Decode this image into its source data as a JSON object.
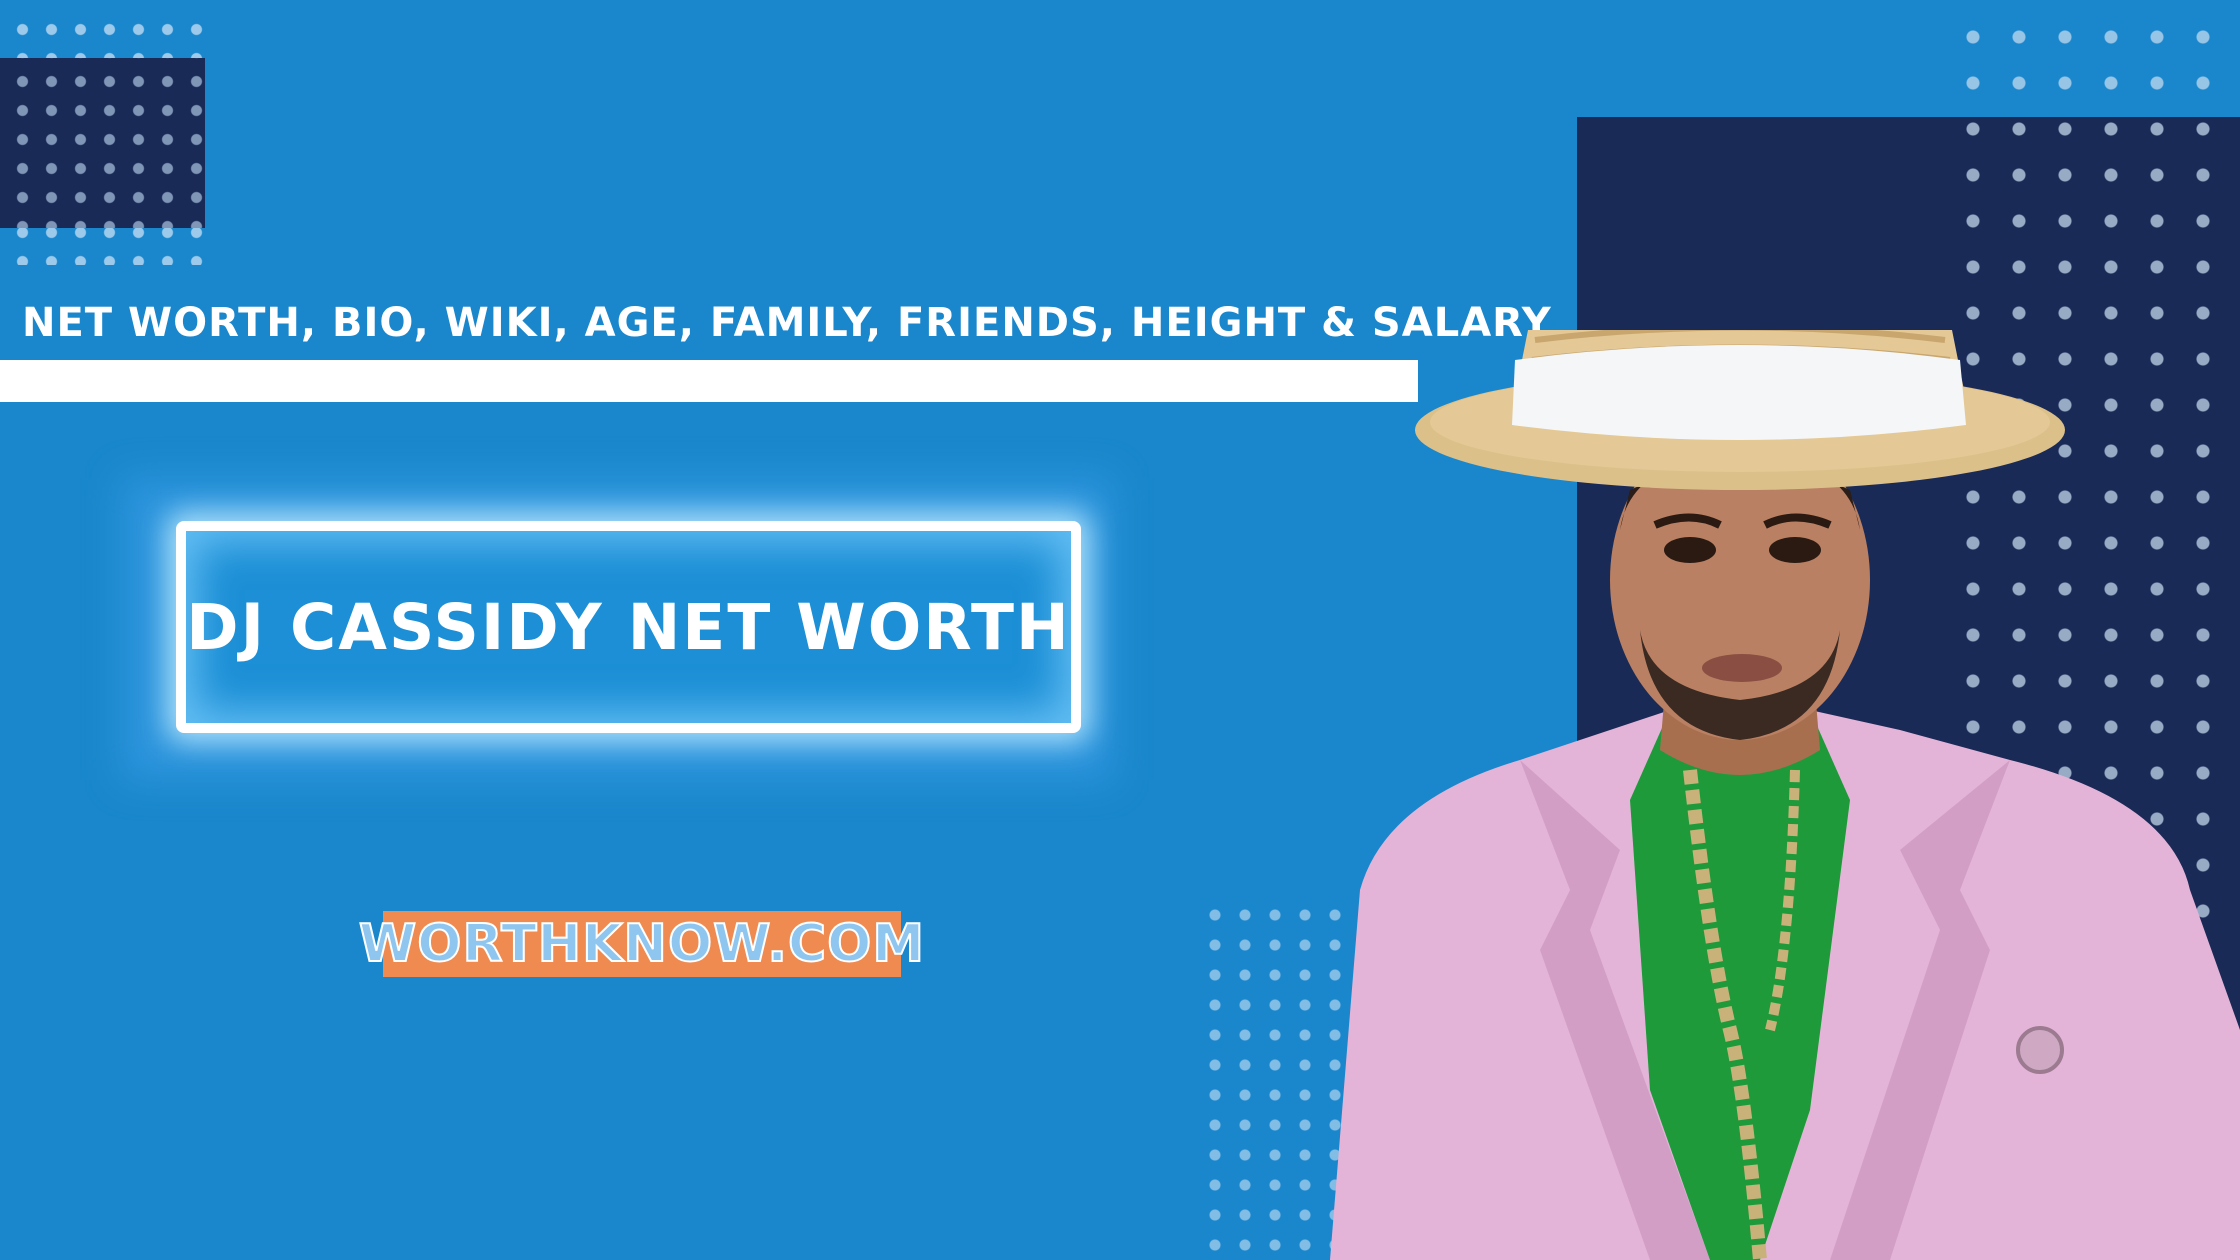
{
  "header": {
    "subtitle": "NET WORTH, BIO, WIKI, AGE, FAMILY, FRIENDS, HEIGHT & SALARY"
  },
  "main": {
    "title": "DJ CASSIDY NET WORTH"
  },
  "footer": {
    "site": "WORTHKNOW.COM"
  },
  "colors": {
    "background": "#1a87cc",
    "dark_panel": "#1a2a56",
    "badge": "#ef8b51",
    "jacket": "#e3b4d8",
    "shirt": "#1f9a3a",
    "hat_straw": "#e4c895"
  }
}
